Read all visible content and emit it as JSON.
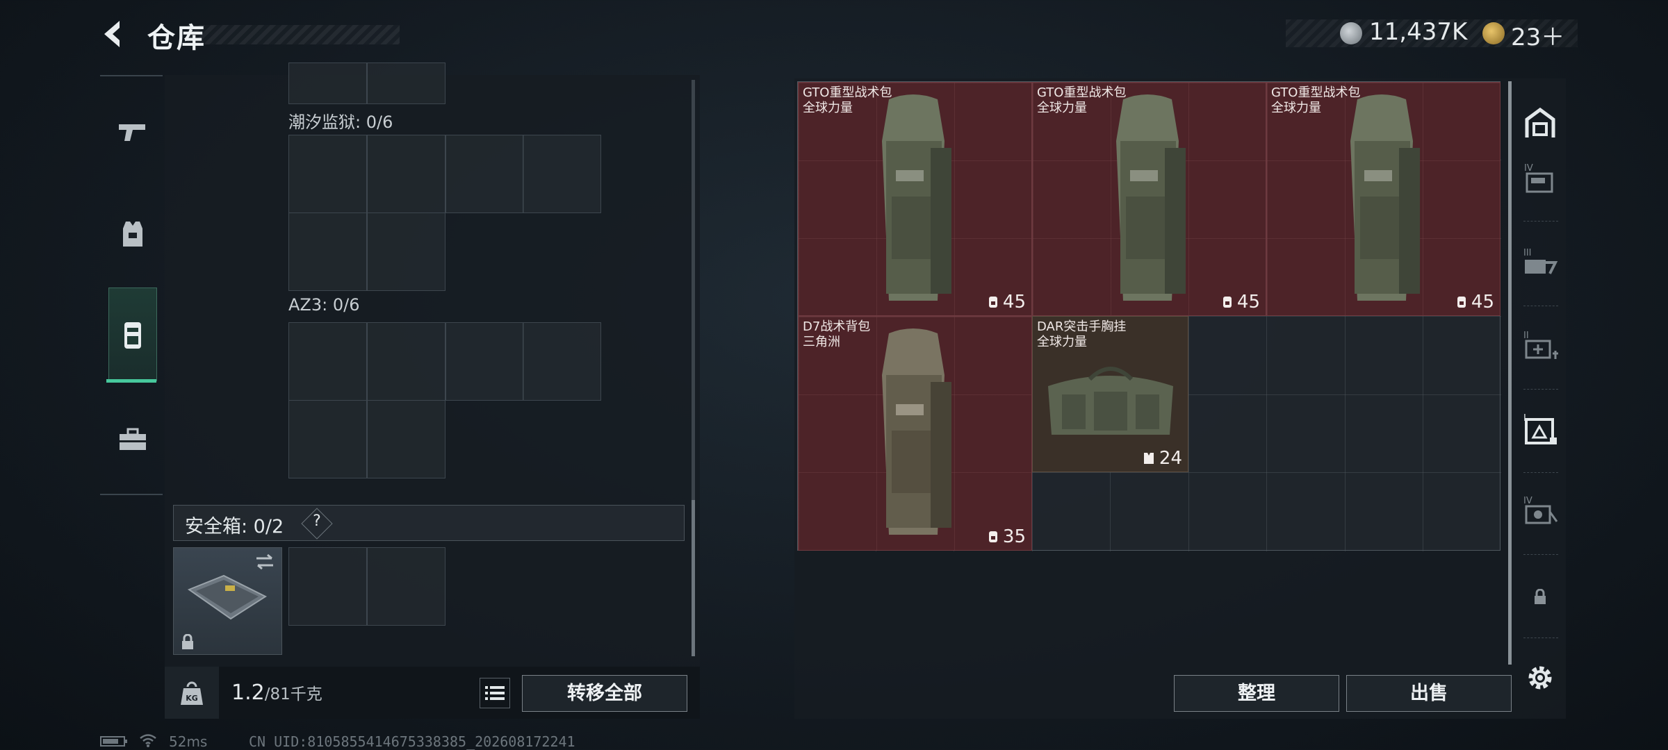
{
  "header": {
    "title": "仓库",
    "currency": [
      {
        "icon": "silver-coin-icon",
        "value": "11,437K"
      },
      {
        "icon": "gold-coin-icon",
        "value": "23＋"
      }
    ]
  },
  "left_panel": {
    "sections": [
      {
        "label": "潮汐监狱: 0/6"
      },
      {
        "label": "AZ3: 0/6"
      }
    ],
    "safe_box": {
      "label": "安全箱: 0/2",
      "help": "?"
    },
    "weight": {
      "value": "1.2",
      "max": "/81千克"
    },
    "transfer_all_label": "转移全部"
  },
  "stash": {
    "items": [
      {
        "name": "GTO重型战术包",
        "sub": "全球力量",
        "capacity": "45",
        "icon": "backpack-icon"
      },
      {
        "name": "GTO重型战术包",
        "sub": "全球力量",
        "capacity": "45",
        "icon": "backpack-icon"
      },
      {
        "name": "GTO重型战术包",
        "sub": "全球力量",
        "capacity": "45",
        "icon": "backpack-icon"
      },
      {
        "name": "D7战术背包",
        "sub": "三角洲",
        "capacity": "35",
        "icon": "backpack-icon"
      },
      {
        "name": "DAR突击手胸挂",
        "sub": "全球力量",
        "capacity": "24",
        "icon": "chest-rig-icon"
      }
    ],
    "sort_label": "整理",
    "sell_label": "出售"
  },
  "status": {
    "ping": "52ms",
    "uid": "CN UID:8105855414675338385_202608172241"
  },
  "colors": {
    "accent": "#47c89c",
    "item_bg": "#4d2328",
    "rig_bg": "#3a3028"
  }
}
